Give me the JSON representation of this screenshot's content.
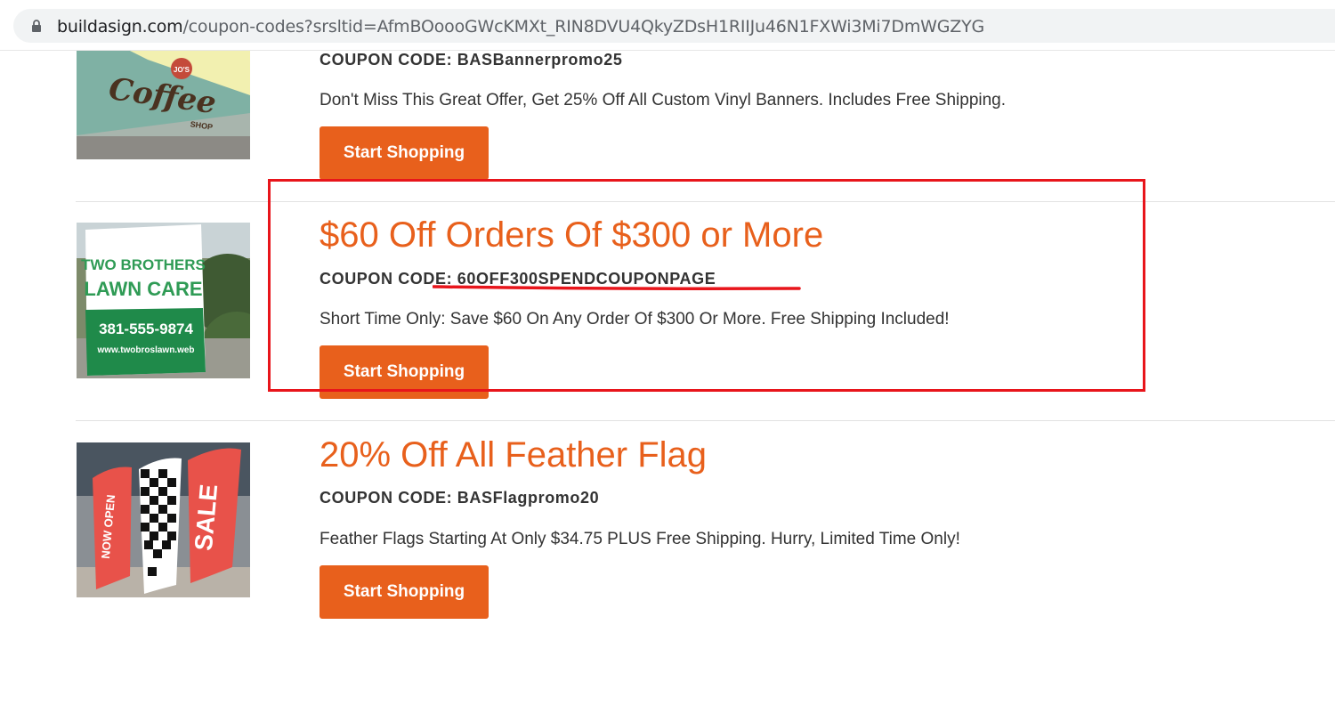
{
  "browser": {
    "url_host": "buildasign.com",
    "url_path": "/coupon-codes?srsltid=AfmBOoooGWcKMXt_RIN8DVU4QkyZDsH1RIIJu46N1FXWi3Mi7DmWGZYG"
  },
  "coupons": [
    {
      "title": "",
      "code_label": "COUPON CODE: BASBannerpromo25",
      "description": "Don't Miss This Great Offer, Get 25% Off All Custom Vinyl Banners. Includes Free Shipping.",
      "button_label": "Start Shopping",
      "image_text": [
        "JO'S",
        "Coffee",
        "SHOP"
      ]
    },
    {
      "title": "$60 Off Orders Of $300 or More",
      "code_label": "COUPON CODE: 60OFF300SPENDCOUPONPAGE",
      "description": "Short Time Only: Save $60 On Any Order Of $300 Or More. Free Shipping Included!",
      "button_label": "Start Shopping",
      "image_text": [
        "TWO BROTHERS",
        "LAWN CARE",
        "381-555-9874",
        "www.twobroslawn.web"
      ]
    },
    {
      "title": "20% Off All Feather Flag",
      "code_label": "COUPON CODE: BASFlagpromo20",
      "description": "Feather Flags Starting At Only $34.75 PLUS Free Shipping. Hurry, Limited Time Only!",
      "button_label": "Start Shopping",
      "image_text": [
        "NOW OPEN",
        "SALE"
      ]
    }
  ],
  "colors": {
    "accent": "#e8601c",
    "annotation": "#e8151b"
  }
}
